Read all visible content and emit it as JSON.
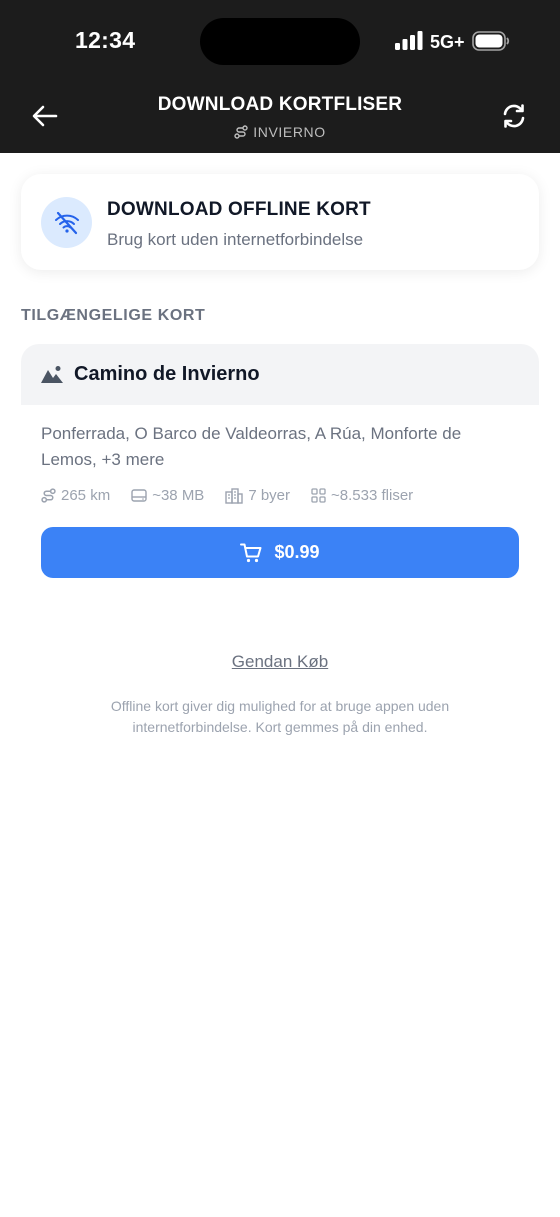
{
  "status_bar": {
    "time": "12:34",
    "network": "5G+"
  },
  "header": {
    "title": "DOWNLOAD KORTFLISER",
    "subtitle": "INVIERNO"
  },
  "offline_card": {
    "title": "DOWNLOAD OFFLINE KORT",
    "subtitle": "Brug kort uden internetforbindelse"
  },
  "section_label": "TILGÆNGELIGE KORT",
  "map": {
    "name": "Camino de Invierno",
    "towns": "Ponferrada, O Barco de Valdeorras, A Rúa, Monforte de Lemos, +3 mere",
    "stats": {
      "distance": "265 km",
      "size": "~38 MB",
      "towns_count": "7 byer",
      "tiles": "~8.533 fliser"
    },
    "price": "$0.99"
  },
  "restore_label": "Gendan Køb",
  "footnote": "Offline kort giver dig mulighed for at bruge appen uden internetforbindelse. Kort gemmes på din enhed.",
  "colors": {
    "accent": "#3b82f6",
    "header_bg": "#1c1c1c",
    "icon_bg": "#dbeafe"
  }
}
